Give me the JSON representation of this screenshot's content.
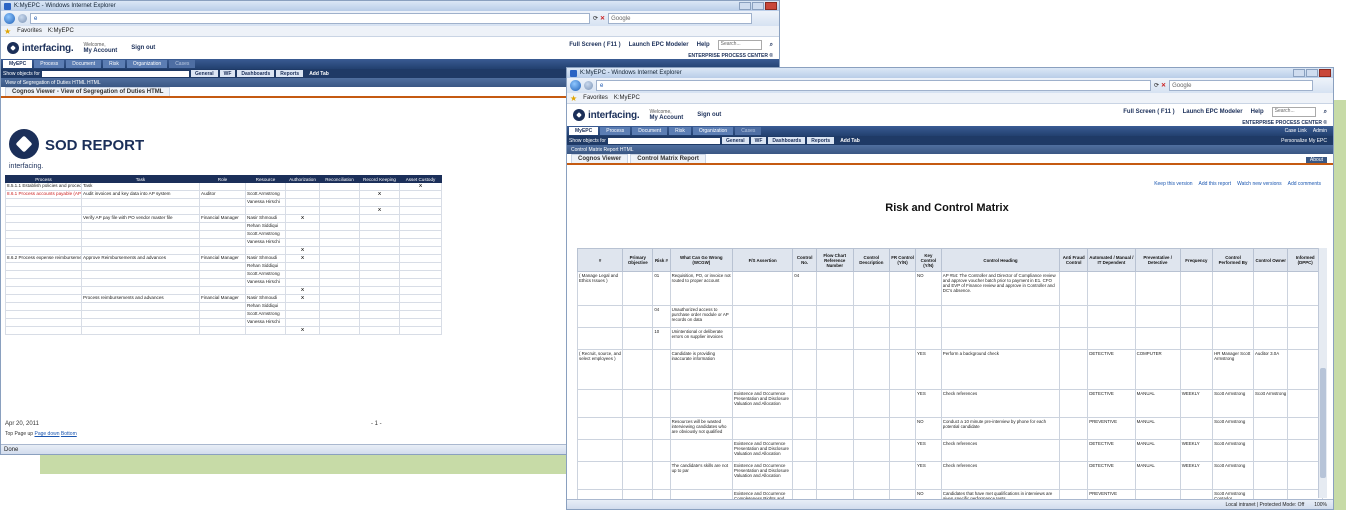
{
  "ie": {
    "sod_title": "K:MyEPC - Windows Internet Explorer",
    "rcm_title": "K:MyEPC - Windows Internet Explorer",
    "search_placeholder": "Google",
    "favorites": "Favorites",
    "tab_title": "K:MyEPC",
    "status_done": "Done",
    "status_zone": "Local intranet | Protected Mode: Off",
    "zoom": "100%"
  },
  "app": {
    "logo": "interfacing.",
    "welcome": "Welcome,",
    "my_account": "My Account",
    "sign_out": "Sign out",
    "full_screen": "Full Screen ( F11 )",
    "launch_modeler": "Launch EPC Modeler",
    "help": "Help",
    "search_placeholder": "Search...",
    "center_title": "ENTERPRISE PROCESS CENTER ®",
    "nav_tabs": [
      "MyEPC",
      "Process",
      "Document",
      "Risk",
      "Organization",
      "Cases"
    ],
    "show_objects_for": "Show objects for",
    "sub_tabs": [
      "General",
      "WF",
      "Dashboards",
      "Reports",
      "Add Tab"
    ],
    "user_links": [
      "Case Link",
      "Admin"
    ],
    "personalize": "Personalize My EPC"
  },
  "sod": {
    "portlet_title": "View of Segregation of Duties HTML HTML",
    "viewer_tab": "Cognos Viewer - View of Segregation of Duties HTML",
    "report_title": "SOD REPORT",
    "brand": "interfacing.",
    "columns": [
      "Process",
      "Task",
      "Role",
      "Resource",
      "Authorization",
      "Reconciliation",
      "Record Keeping",
      "Asset Custody"
    ],
    "rows": [
      [
        "8.5.1.1 Establish policies and procedures",
        "Task",
        "",
        "",
        "",
        "",
        "",
        "X"
      ],
      [
        "8.6.1 Process accounts payable (AP)",
        "Audit invoices and key data into AP system",
        "Auditor",
        "Scott  Armstrong",
        "",
        "",
        "X",
        ""
      ],
      [
        "",
        "",
        "",
        "Vanessa  Hirschi",
        "",
        "",
        "",
        ""
      ],
      [
        "",
        "",
        "",
        "",
        "",
        "",
        "X",
        ""
      ],
      [
        "",
        "Verify AP pay file with PO vendor master file",
        "Financial Manager",
        "Nasir  Shmoudi",
        "X",
        "",
        "",
        ""
      ],
      [
        "",
        "",
        "",
        "Rehan  Siddiqui",
        "",
        "",
        "",
        ""
      ],
      [
        "",
        "",
        "",
        "Scott  Armstrong",
        "",
        "",
        "",
        ""
      ],
      [
        "",
        "",
        "",
        "Vanessa  Hirschi",
        "",
        "",
        "",
        ""
      ],
      [
        "",
        "",
        "",
        "",
        "X",
        "",
        "",
        ""
      ],
      [
        "8.6.2 Process expense reimbursements",
        "Approve Reimbursements and advances",
        "Financial Manager",
        "Nasir  Shmoudi",
        "X",
        "",
        "",
        ""
      ],
      [
        "",
        "",
        "",
        "Rehan  Siddiqui",
        "",
        "",
        "",
        ""
      ],
      [
        "",
        "",
        "",
        "Scott  Armstrong",
        "",
        "",
        "",
        ""
      ],
      [
        "",
        "",
        "",
        "Vanessa  Hirschi",
        "",
        "",
        "",
        ""
      ],
      [
        "",
        "",
        "",
        "",
        "X",
        "",
        "",
        ""
      ],
      [
        "",
        "Process reimbursements and advances",
        "Financial Manager",
        "Nasir  Shmoudi",
        "X",
        "",
        "",
        ""
      ],
      [
        "",
        "",
        "",
        "Rehan  Siddiqui",
        "",
        "",
        "",
        ""
      ],
      [
        "",
        "",
        "",
        "Scott  Armstrong",
        "",
        "",
        "",
        ""
      ],
      [
        "",
        "",
        "",
        "Vanessa  Hirschi",
        "",
        "",
        "",
        ""
      ],
      [
        "",
        "",
        "",
        "",
        "X",
        "",
        "",
        ""
      ]
    ],
    "footer_date": "Apr 20, 2011",
    "footer_page": "- 1 -",
    "footer_links": [
      "Top",
      "Page up",
      "Page down",
      "Bottom"
    ]
  },
  "rcm": {
    "portlet_title": "Control Matrix Report HTML",
    "tabs": [
      "Cognos Viewer",
      "Control Matrix Report"
    ],
    "toolbar": [
      "Keep this version",
      "Add this report",
      "Watch new versions",
      "Add comments"
    ],
    "about": "About",
    "title": "Risk and Control Matrix",
    "columns": [
      "#",
      "Primary Objective",
      "Risk #",
      "What Can Go Wrong (WCGW)",
      "F/S Assertion",
      "Control No.",
      "Flow Chart Reference Number",
      "Control Description",
      "FR Control (Y/N)",
      "Key Control (Y/N)",
      "Control Heading",
      "Anti Fraud Control",
      "Automated / Manual / IT Dependent",
      "Preventative / Detective",
      "Frequency",
      "Control Performed By",
      "Control Owner",
      "Informed (DPPC)"
    ],
    "rows": [
      [
        "( Manage Legal and Ethics Issues )",
        "",
        "01",
        "Requisition, PO, or invoice not routed to proper account",
        "",
        "04",
        "",
        "",
        "",
        "NO",
        "AP #54: The Controller and Director of Compliance review and approve voucher batch prior to payment in E1. CFO and EVP of Finance review and approve in Controller and DC's absence.",
        "",
        "",
        "",
        "",
        "",
        "",
        ""
      ],
      [
        "",
        "",
        "04",
        "Unauthorized access to purchase order module or AP records on data",
        "",
        "",
        "",
        "",
        "",
        "",
        "",
        "",
        "",
        "",
        "",
        "",
        "",
        ""
      ],
      [
        "",
        "",
        "10",
        "Unintentional or deliberate errors on supplier invoices",
        "",
        "",
        "",
        "",
        "",
        "",
        "",
        "",
        "",
        "",
        "",
        "",
        "",
        ""
      ],
      [
        "( Recruit, source, and select employees )",
        "",
        "",
        "Candidate is providing inaccurate information",
        "",
        "",
        "",
        "",
        "",
        "YES",
        "Perform a background check",
        "",
        "DETECTIVE",
        "COMPUTER",
        "",
        "HR Manager  Scott Armstrong",
        "Auditor 3.0A",
        ""
      ],
      [
        "",
        "",
        "",
        "",
        "Existence and Occurrence  Presentation and Disclosure Valuation and Allocation",
        "",
        "",
        "",
        "",
        "YES",
        "Check references",
        "",
        "DETECTIVE",
        "MANUAL",
        "WEEKLY",
        "Scott Armstrong",
        "Scott Armstrong",
        ""
      ],
      [
        "",
        "",
        "",
        "Resources will be wasted interviewing candidates who are obviously not qualified",
        "",
        "",
        "",
        "",
        "",
        "NO",
        "Conduct a 10 minute pre-interview by phone for each potential candidate",
        "",
        "PREVENTIVE",
        "MANUAL",
        "",
        "Scott Armstrong",
        "",
        ""
      ],
      [
        "",
        "",
        "",
        "",
        "Existence and Occurrence  Presentation and Disclosure Valuation and Allocation",
        "",
        "",
        "",
        "",
        "YES",
        "Check references",
        "",
        "DETECTIVE",
        "MANUAL",
        "WEEKLY",
        "Scott Armstrong",
        "",
        ""
      ],
      [
        "",
        "",
        "",
        "The candidate's skills are not up to par",
        "Existence and Occurrence  Presentation and Disclosure Valuation and Allocation",
        "",
        "",
        "",
        "",
        "YES",
        "Check references",
        "",
        "DETECTIVE",
        "MANUAL",
        "WEEKLY",
        "Scott Armstrong",
        "",
        ""
      ],
      [
        "",
        "",
        "",
        "",
        "Existence and Occurrence  Completeness Rights and Obligations Presentation and Disclosure",
        "",
        "",
        "",
        "",
        "NO",
        "Candidates that have met qualifications in interviews are given specific performance tests",
        "",
        "PREVENTIVE",
        "",
        "",
        "Scott Armstrong  Contador",
        "",
        ""
      ]
    ]
  }
}
